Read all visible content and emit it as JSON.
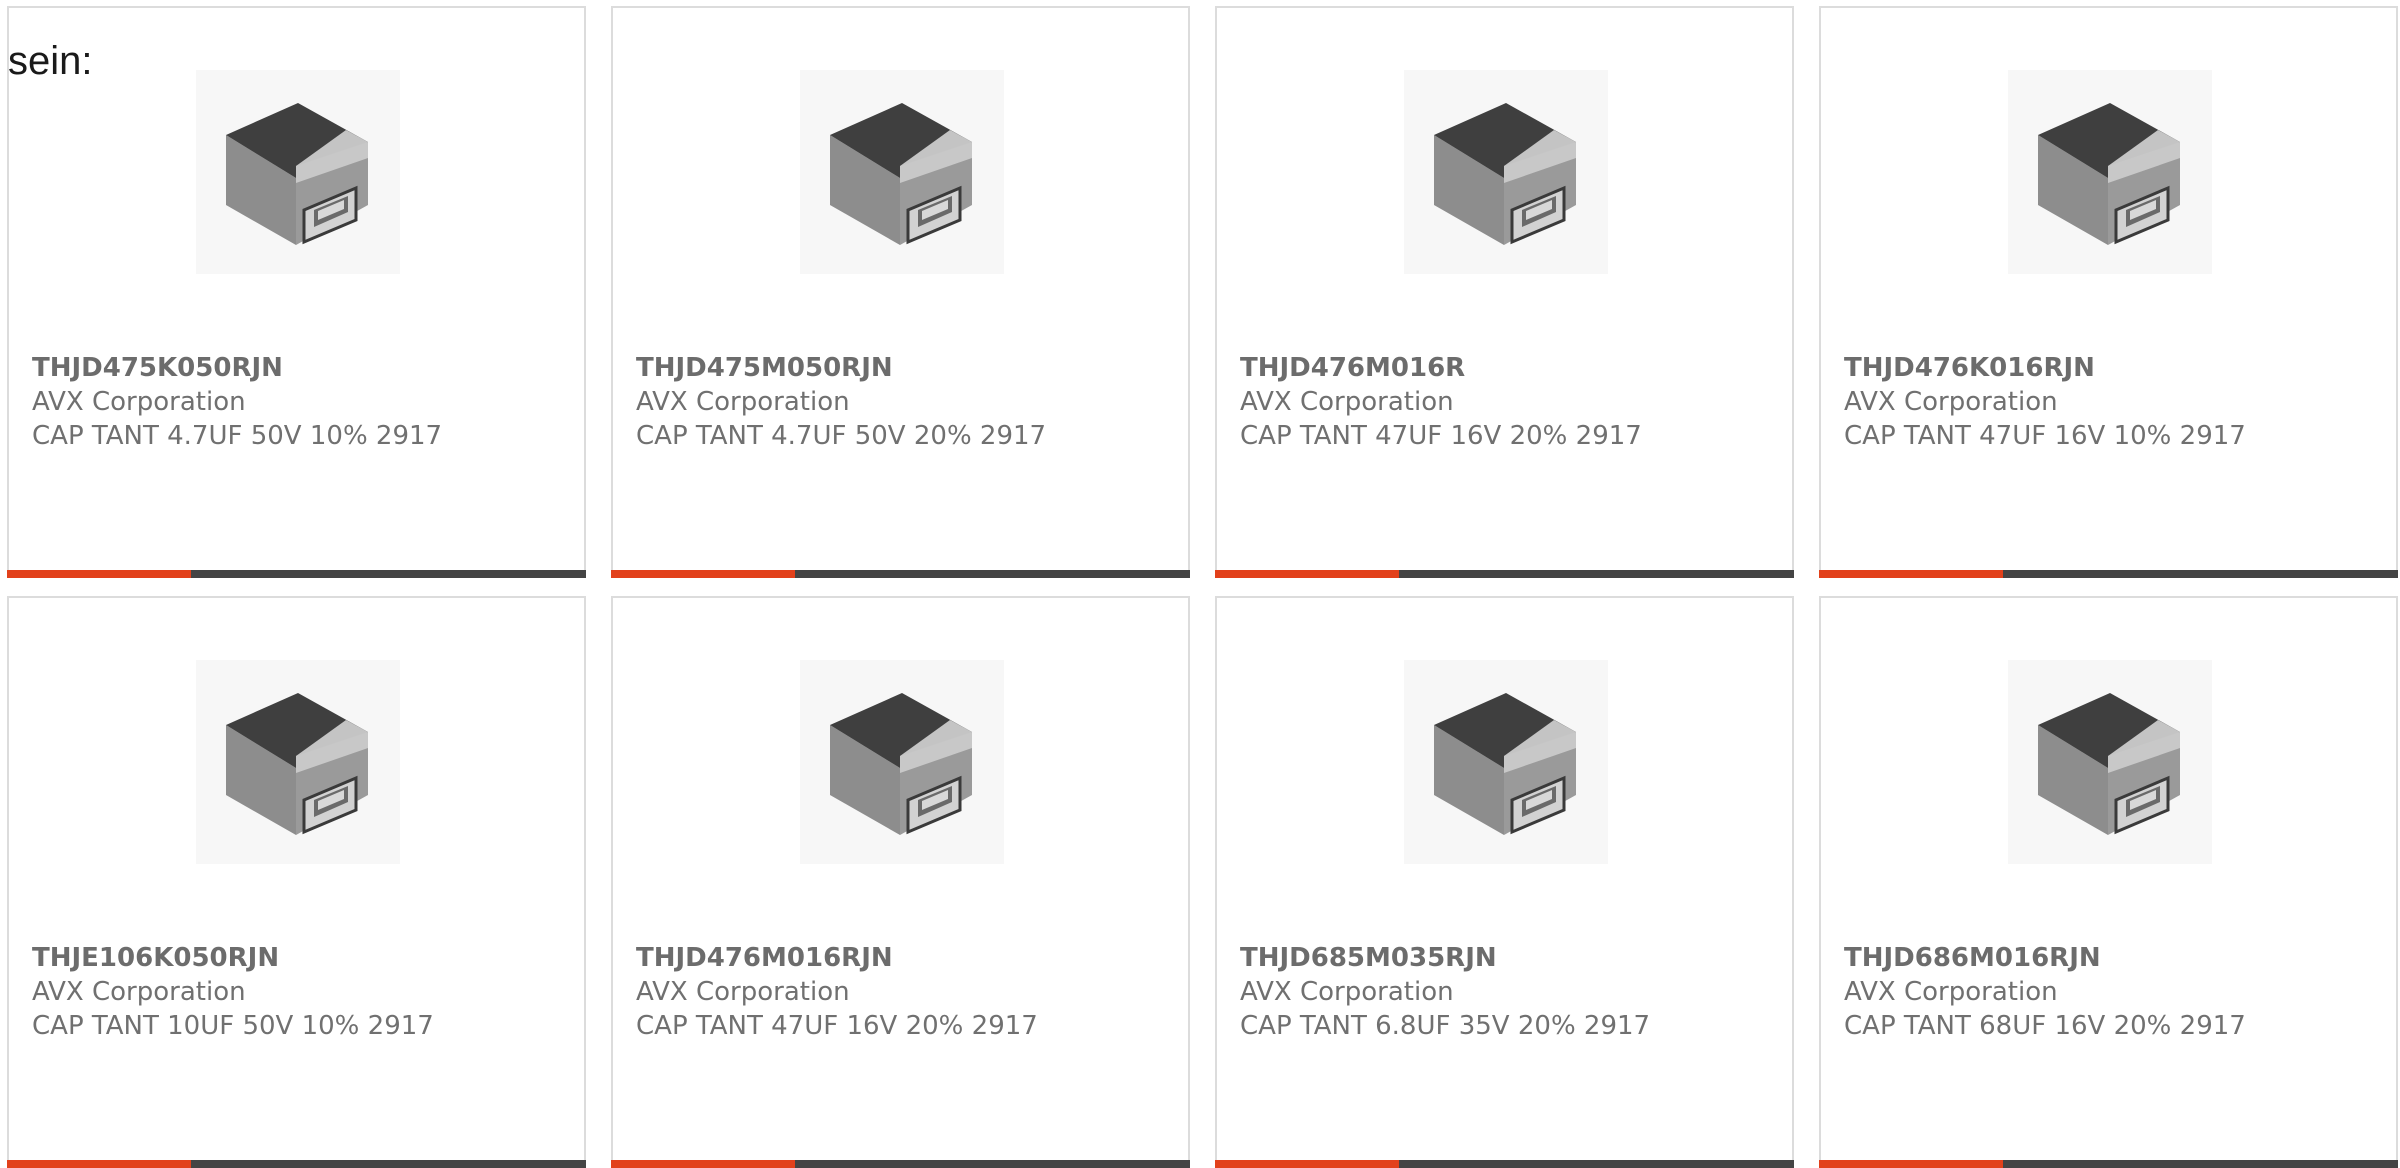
{
  "intro_text": "sein:",
  "colors": {
    "accent": "#e2411b",
    "bar": "#444444",
    "card_border": "#dcdcdc",
    "text": "#707070"
  },
  "product_icon": "smd-tantalum-capacitor-image",
  "cards": [
    {
      "part": "THJD475K050RJN",
      "manufacturer": "AVX Corporation",
      "description": "CAP TANT 4.7UF 50V 10% 2917"
    },
    {
      "part": "THJD475M050RJN",
      "manufacturer": "AVX Corporation",
      "description": "CAP TANT 4.7UF 50V 20% 2917"
    },
    {
      "part": "THJD476M016R",
      "manufacturer": "AVX Corporation",
      "description": "CAP TANT 47UF 16V 20% 2917"
    },
    {
      "part": "THJD476K016RJN",
      "manufacturer": "AVX Corporation",
      "description": "CAP TANT 47UF 16V 10% 2917"
    },
    {
      "part": "THJE106K050RJN",
      "manufacturer": "AVX Corporation",
      "description": "CAP TANT 10UF 50V 10% 2917"
    },
    {
      "part": "THJD476M016RJN",
      "manufacturer": "AVX Corporation",
      "description": "CAP TANT 47UF 16V 20% 2917"
    },
    {
      "part": "THJD685M035RJN",
      "manufacturer": "AVX Corporation",
      "description": "CAP TANT 6.8UF 35V 20% 2917"
    },
    {
      "part": "THJD686M016RJN",
      "manufacturer": "AVX Corporation",
      "description": "CAP TANT 68UF 16V 20% 2917"
    }
  ]
}
